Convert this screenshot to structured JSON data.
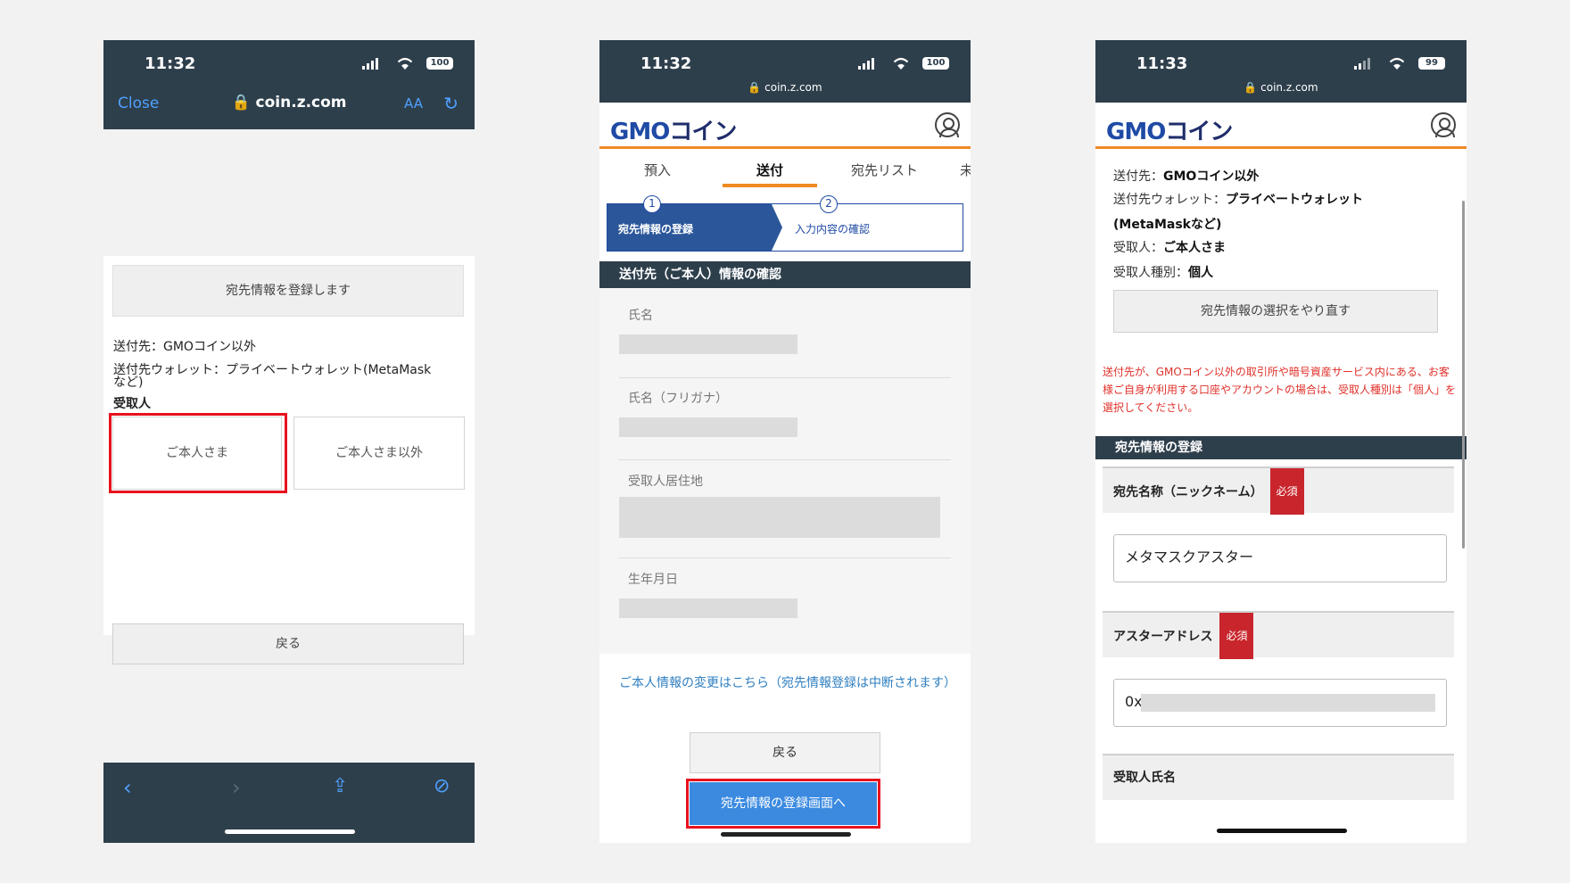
{
  "phone1": {
    "time": "11:32",
    "battery": "100",
    "close_label": "Close",
    "url": "🔒 coin.z.com",
    "aa_label": "AA",
    "header_box": "宛先情報を登録します",
    "line_dest": "送付先：GMOコイン以外",
    "line_wallet_1": "送付先ウォレット：プライベートウォレット(MetaMask",
    "line_wallet_2": "など)",
    "recipient_label": "受取人",
    "opt_self": "ご本人さま",
    "opt_other": "ご本人さま以外",
    "back_label": "戻る"
  },
  "phone2": {
    "time": "11:32",
    "battery": "100",
    "url": "🔒 coin.z.com",
    "tabs": [
      "預入",
      "送付",
      "宛先リスト",
      "未"
    ],
    "step1": "宛先情報の登録",
    "step2": "入力内容の確認",
    "step1_num": "1",
    "step2_num": "2",
    "section_title": "送付先（ご本人）情報の確認",
    "fields": [
      "氏名",
      "氏名（フリガナ）",
      "受取人居住地",
      "生年月日"
    ],
    "link_text": "ご本人情報の変更はこちら（宛先情報登録は中断されます）",
    "back_label": "戻る",
    "next_label": "宛先情報の登録画面へ"
  },
  "phone3": {
    "time": "11:33",
    "battery": "99",
    "url": "🔒 coin.z.com",
    "info_dest_key": "送付先：",
    "info_dest_val": "GMOコイン以外",
    "info_wallet_key": "送付先ウォレット：",
    "info_wallet_val": "プライベートウォレット",
    "info_wallet_val2": "(MetaMaskなど)",
    "info_recipient_key": "受取人：",
    "info_recipient_val": "ご本人さま",
    "info_type_key": "受取人種別：",
    "info_type_val": "個人",
    "reselect_label": "宛先情報の選択をやり直す",
    "note": "送付先が、GMOコイン以外の取引所や暗号資産サービス内にある、お客様ご自身が利用する口座やアカウントの場合は、受取人種別は「個人」を選択してください。",
    "section_title": "宛先情報の登録",
    "field_nickname": "宛先名称（ニックネーム）",
    "required": "必須",
    "nickname_value": "メタマスクアスター",
    "field_address": "アスターアドレス",
    "address_prefix": "0x",
    "field_name": "受取人氏名"
  },
  "brand": {
    "gmo": "GMO",
    "coin": "コイン",
    "accent": "#f08a24",
    "highlight": "#e8121e"
  }
}
